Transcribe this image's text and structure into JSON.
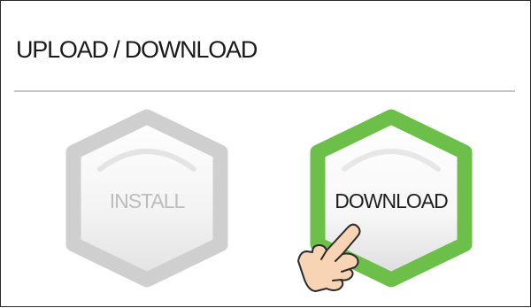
{
  "panel": {
    "title": "UPLOAD / DOWNLOAD"
  },
  "buttons": {
    "install": {
      "label": "INSTALL",
      "state": "disabled",
      "color": "#c8c8c8"
    },
    "download": {
      "label": "DOWNLOAD",
      "state": "active",
      "color": "#6cc04a"
    }
  },
  "icons": {
    "pointer": "hand-pointer-icon"
  }
}
